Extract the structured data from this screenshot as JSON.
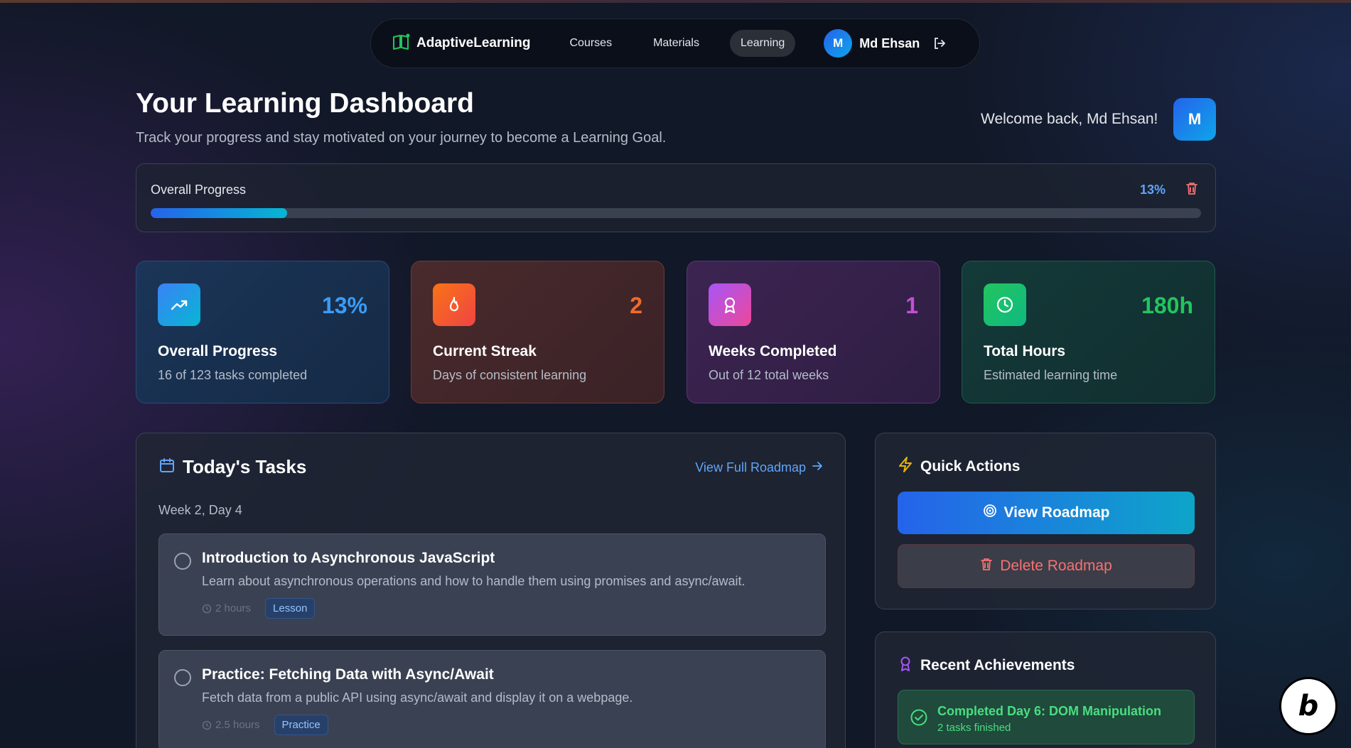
{
  "nav": {
    "brand": "AdaptiveLearning",
    "links": [
      "Courses",
      "Materials",
      "Learning"
    ],
    "user_initial": "M",
    "user_name": "Md Ehsan"
  },
  "header": {
    "title": "Your Learning Dashboard",
    "subtitle": "Track your progress and stay motivated on your journey to become a Learning Goal.",
    "welcome": "Welcome back, Md Ehsan!",
    "avatar_initial": "M"
  },
  "progress": {
    "label": "Overall Progress",
    "percent_text": "13%",
    "fraction": 0.13
  },
  "stats": [
    {
      "value": "13%",
      "title": "Overall Progress",
      "sub": "16 of 123 tasks completed",
      "icon": "trending-up-icon",
      "color": "#3b9cf6"
    },
    {
      "value": "2",
      "title": "Current Streak",
      "sub": "Days of consistent learning",
      "icon": "flame-icon",
      "color": "#f26a2a"
    },
    {
      "value": "1",
      "title": "Weeks Completed",
      "sub": "Out of 12 total weeks",
      "icon": "award-icon",
      "color": "#c44ed8"
    },
    {
      "value": "180h",
      "title": "Total Hours",
      "sub": "Estimated learning time",
      "icon": "clock-icon",
      "color": "#22c55e"
    }
  ],
  "tasks": {
    "title": "Today's Tasks",
    "roadmap_link": "View Full Roadmap",
    "week_label": "Week 2, Day 4",
    "items": [
      {
        "title": "Introduction to Asynchronous JavaScript",
        "desc": "Learn about asynchronous operations and how to handle them using promises and async/await.",
        "duration": "2 hours",
        "tag": "Lesson"
      },
      {
        "title": "Practice: Fetching Data with Async/Await",
        "desc": "Fetch data from a public API using async/await and display it on a webpage.",
        "duration": "2.5 hours",
        "tag": "Practice"
      }
    ]
  },
  "quick_actions": {
    "title": "Quick Actions",
    "view_label": "View Roadmap",
    "delete_label": "Delete Roadmap"
  },
  "achievements": {
    "title": "Recent Achievements",
    "items": [
      {
        "title": "Completed Day 6: DOM Manipulation",
        "sub": "2 tasks finished"
      }
    ]
  },
  "colors": {
    "accent": "#2563eb",
    "link": "#60a5fa",
    "danger": "#f87171",
    "success": "#4ade80"
  }
}
